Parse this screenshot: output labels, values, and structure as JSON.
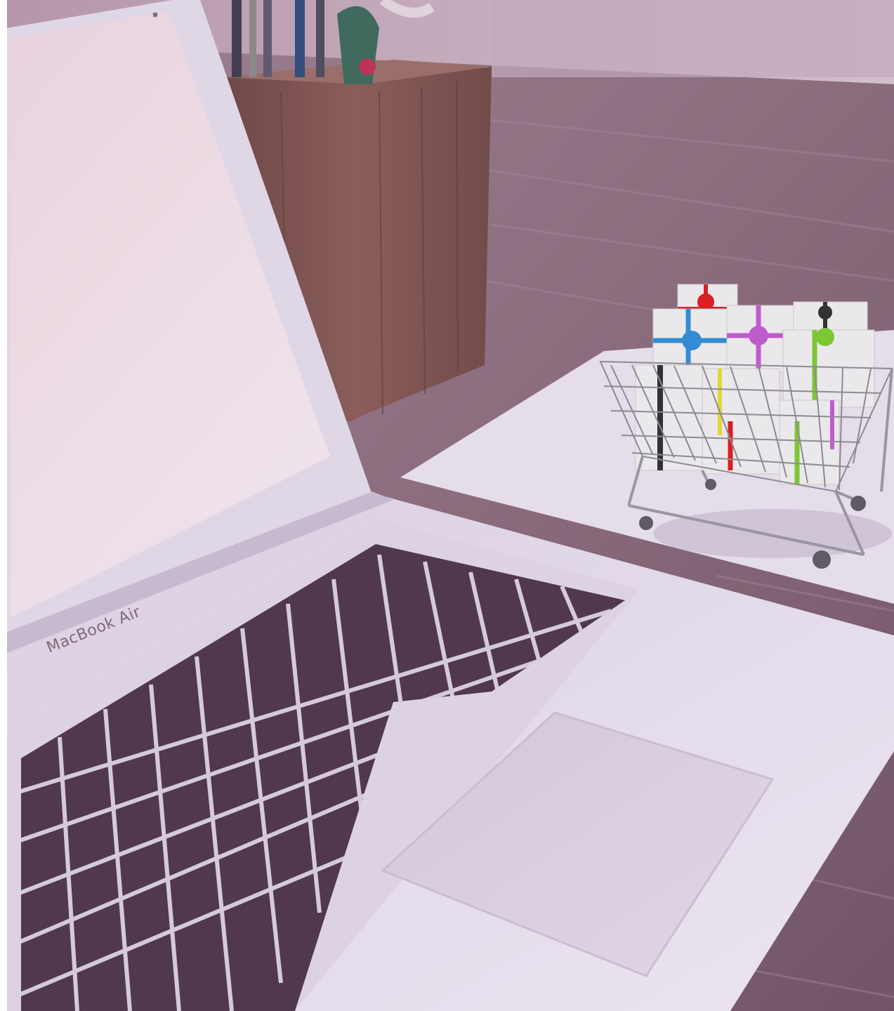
{
  "photo": {
    "laptop_brand": "MacBook Air",
    "colors": {
      "desk_wood": "#8a6c7a",
      "desk_wood_light": "#a88f9d",
      "wall": "#c9b3c0",
      "laptop_body": "#e9e2ee",
      "laptop_body_shadow": "#cfc4d6",
      "screen": "#f2dde6",
      "keys": "#4b3447",
      "trackpad": "#ddd5e2",
      "paper": "#ece7f0",
      "pencil_cup": "#7a4d47",
      "cart_wire": "#8c8c92",
      "gift_white": "#f2f2f2",
      "ribbon_red": "#e01818",
      "ribbon_blue": "#2a8fd8",
      "ribbon_pink": "#c25bd0",
      "ribbon_green": "#7ad02a",
      "ribbon_black": "#2c2c2c",
      "ribbon_yellow": "#e8e030"
    }
  }
}
